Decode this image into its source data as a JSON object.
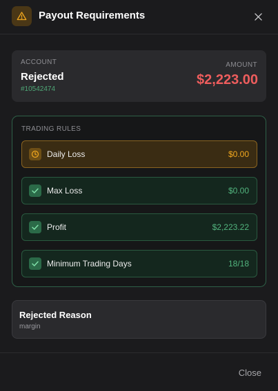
{
  "dialog": {
    "title": "Payout Requirements",
    "close_label": "Close"
  },
  "account": {
    "label": "ACCOUNT",
    "status": "Rejected",
    "id": "#10542474",
    "amount_label": "AMOUNT",
    "amount": "$2,223.00"
  },
  "rules": {
    "label": "TRADING RULES",
    "items": [
      {
        "name": "Daily Loss",
        "value": "$0.00",
        "state": "warning",
        "icon": "clock-icon"
      },
      {
        "name": "Max Loss",
        "value": "$0.00",
        "state": "passed",
        "icon": "check-icon"
      },
      {
        "name": "Profit",
        "value": "$2,223.22",
        "state": "passed",
        "icon": "check-icon"
      },
      {
        "name": "Minimum Trading Days",
        "value": "18/18",
        "state": "passed",
        "icon": "check-icon"
      }
    ]
  },
  "reason": {
    "title": "Rejected Reason",
    "text": "margin"
  },
  "colors": {
    "danger": "#ee5d5d",
    "success": "#52b47e",
    "warning": "#f2a81e"
  }
}
